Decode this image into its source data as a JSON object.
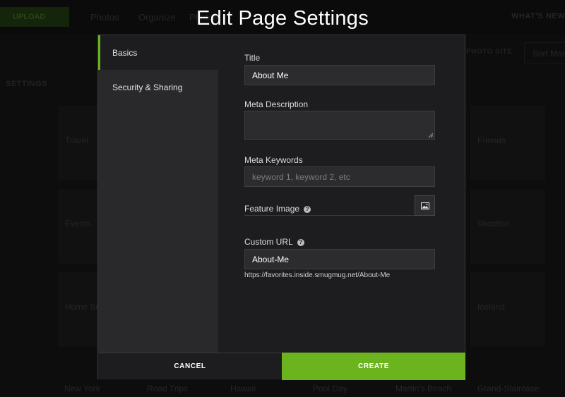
{
  "background": {
    "upload_label": "UPLOAD",
    "nav": [
      "Photos",
      "Organize",
      "Photos"
    ],
    "whats_new": "WHAT'S NEW",
    "settings_label": "SETTINGS",
    "photo_site_label": "PHOTO SITE",
    "sort_label": "Sort Man",
    "tiles": [
      "Travel",
      "Friends",
      "Events",
      "Vacation",
      "Home Sc",
      "Iceland"
    ],
    "bottom_labels": [
      "New York",
      "Road Trips",
      "Hawaii",
      "Pool Day",
      "Martin's Beach",
      "Grand-Staircase"
    ]
  },
  "modal": {
    "title": "Edit Page Settings",
    "sidebar": [
      {
        "label": "Basics",
        "active": true
      },
      {
        "label": "Security & Sharing",
        "active": false
      }
    ],
    "form": {
      "title_label": "Title",
      "title_value": "About Me",
      "meta_description_label": "Meta Description",
      "meta_description_value": "",
      "meta_keywords_label": "Meta Keywords",
      "meta_keywords_placeholder": "keyword 1, keyword 2, etc",
      "feature_image_label": "Feature Image",
      "custom_url_label": "Custom URL",
      "custom_url_value": "About-Me",
      "url_preview": "https://favorites.inside.smugmug.net/About-Me"
    },
    "footer": {
      "cancel_label": "CANCEL",
      "create_label": "CREATE"
    },
    "colors": {
      "accent": "#6bb41e",
      "panel": "#1d1d20",
      "sidebar": "#29292c",
      "input": "#2c2c2f"
    }
  }
}
